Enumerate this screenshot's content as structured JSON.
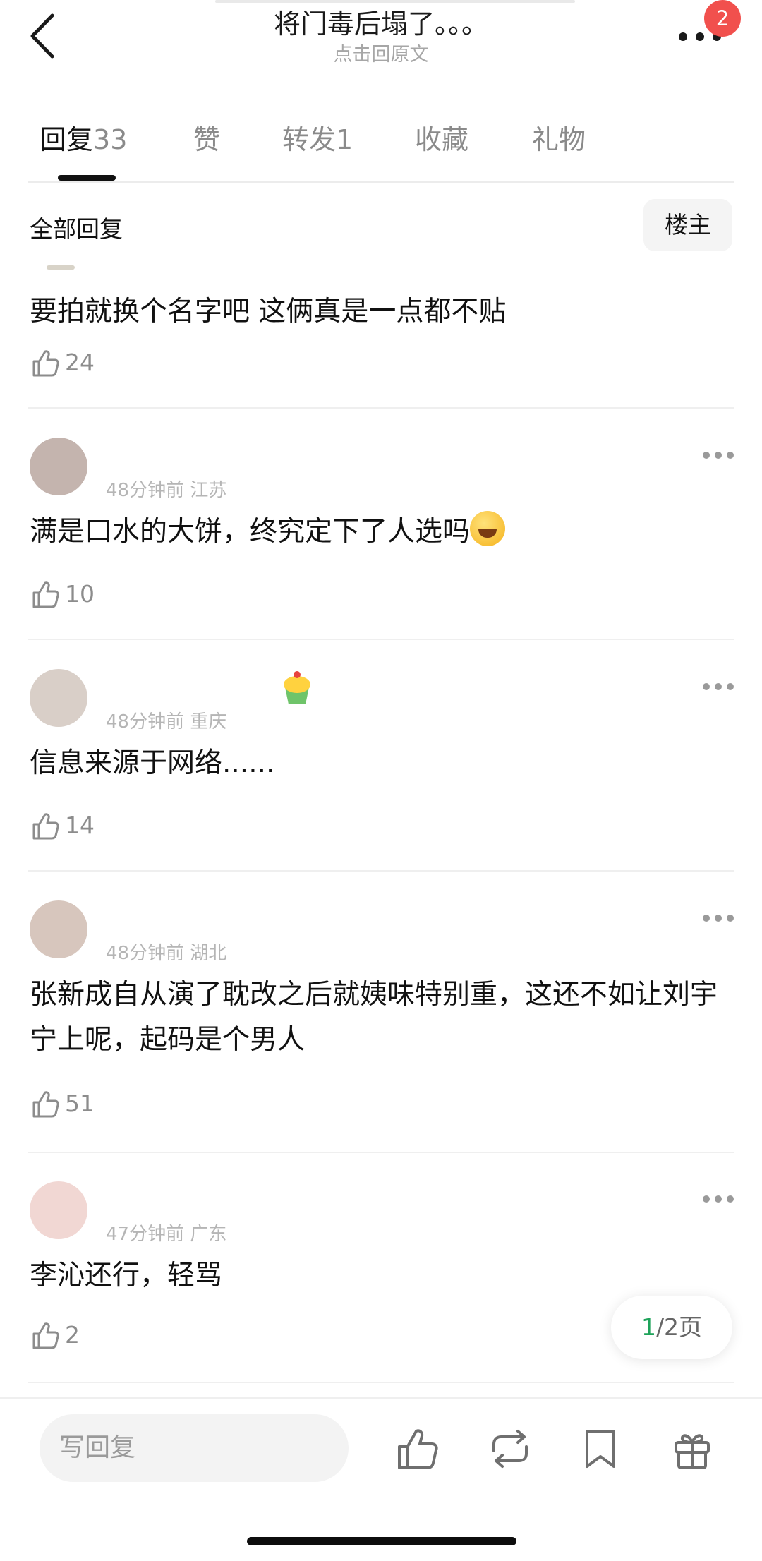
{
  "header": {
    "title": "将门毒后塌了。。。",
    "subtitle": "点击回原文",
    "notification_count": "2"
  },
  "tabs": [
    {
      "label": "回复",
      "count": "33"
    },
    {
      "label": "赞",
      "count": ""
    },
    {
      "label": "转发",
      "count": "1"
    },
    {
      "label": "收藏",
      "count": ""
    },
    {
      "label": "礼物",
      "count": ""
    }
  ],
  "section": {
    "title": "全部回复",
    "owner_button": "楼主"
  },
  "comments": [
    {
      "meta": "",
      "text": "要拍就换个名字吧 这俩真是一点都不贴",
      "likes": "24"
    },
    {
      "meta": "48分钟前 江苏",
      "text": "满是口水的大饼，终究定下了人选吗",
      "likes": "10"
    },
    {
      "meta": "48分钟前 重庆",
      "text": "信息来源于网络......",
      "likes": "14"
    },
    {
      "meta": "48分钟前 湖北",
      "text": "张新成自从演了耽改之后就姨味特别重，这还不如让刘宇宁上呢，起码是个男人",
      "likes": "51"
    },
    {
      "meta": "47分钟前 广东",
      "text": "李沁还行，轻骂",
      "likes": "2"
    }
  ],
  "pager": {
    "current": "1",
    "rest": "/2页"
  },
  "bottom": {
    "reply_placeholder": "写回复"
  },
  "colors": {
    "accent_green": "#1ea35a",
    "badge_red": "#f1504d"
  }
}
